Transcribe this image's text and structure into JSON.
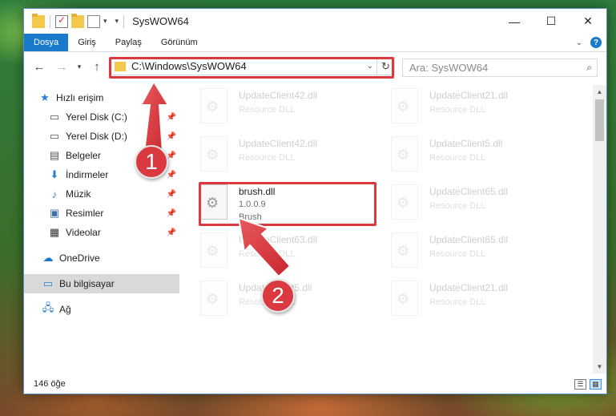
{
  "window": {
    "title": "SysWOW64",
    "controls": [
      "—",
      "☐",
      "✕"
    ]
  },
  "ribbon": {
    "tabs": [
      {
        "label": "Dosya"
      },
      {
        "label": "Giriş"
      },
      {
        "label": "Paylaş"
      },
      {
        "label": "Görünüm"
      }
    ],
    "help_label": "?"
  },
  "address": {
    "path": "C:\\Windows\\SysWOW64",
    "search_placeholder": "Ara: SysWOW64"
  },
  "nav": {
    "items": [
      {
        "label": "Hızlı erişim",
        "icon": "star-icon"
      },
      {
        "label": "Yerel Disk (C:)",
        "icon": "drive-icon"
      },
      {
        "label": "Yerel Disk (D:)",
        "icon": "drive-icon"
      },
      {
        "label": "Belgeler",
        "icon": "documents-icon"
      },
      {
        "label": "İndirmeler",
        "icon": "download-icon"
      },
      {
        "label": "Müzik",
        "icon": "music-icon"
      },
      {
        "label": "Resimler",
        "icon": "pictures-icon"
      },
      {
        "label": "Videolar",
        "icon": "videos-icon"
      },
      {
        "label": "OneDrive",
        "icon": "cloud-icon"
      },
      {
        "label": "Bu bilgisayar",
        "icon": "computer-icon"
      },
      {
        "label": "Ağ",
        "icon": "network-icon"
      }
    ]
  },
  "files": [
    {
      "name": "UpdateClient42.dll",
      "type": "Resource DLL"
    },
    {
      "name": "UpdateClient21.dll",
      "type": "Resource DLL"
    },
    {
      "name": "UpdateClient42.dll",
      "type": "Resource DLL"
    },
    {
      "name": "UpdateClient5.dll",
      "type": "Resource DLL"
    },
    {
      "name": "brush.dll",
      "version": "1.0.0.9",
      "type": "Brush"
    },
    {
      "name": "UpdateClient65.dll",
      "type": "Resource DLL"
    },
    {
      "name": "UpdateClient63.dll",
      "type": "Resource DLL"
    },
    {
      "name": "UpdateClient65.dll",
      "type": "Resource DLL"
    },
    {
      "name": "UpdateClient5.dll",
      "type": "Resource DLL"
    },
    {
      "name": "UpdateClient21.dll",
      "type": "Resource DLL"
    }
  ],
  "status": {
    "count": "146 öğe"
  },
  "callouts": [
    "1",
    "2"
  ],
  "colors": {
    "accent": "#1979ca",
    "highlight": "#d9393f"
  }
}
